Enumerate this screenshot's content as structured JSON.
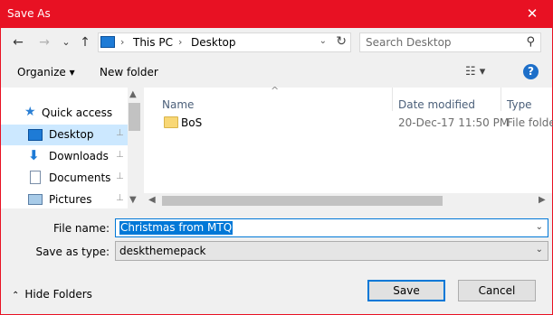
{
  "window": {
    "title": "Save As",
    "close_glyph": "✕"
  },
  "navigation": {
    "back_glyph": "←",
    "forward_glyph": "→",
    "recent_glyph": "⌄",
    "up_glyph": "↑",
    "breadcrumb": [
      "This PC",
      "Desktop"
    ],
    "crumb_sep": "›",
    "dropdown_glyph": "⌄",
    "refresh_glyph": "↻"
  },
  "search": {
    "placeholder": "Search Desktop",
    "icon": "search-icon",
    "icon_glyph": "⚲"
  },
  "toolbar": {
    "organize_label": "Organize ▾",
    "new_folder_label": "New folder",
    "view_glyph": "☷ ▾",
    "help_glyph": "?"
  },
  "sidebar": {
    "items": [
      {
        "label": "Quick access",
        "icon": "star-icon",
        "pinned": false,
        "selected": false
      },
      {
        "label": "Desktop",
        "icon": "desktop-icon",
        "pinned": true,
        "selected": true
      },
      {
        "label": "Downloads",
        "icon": "download-icon",
        "pinned": true,
        "selected": false
      },
      {
        "label": "Documents",
        "icon": "document-icon",
        "pinned": true,
        "selected": false
      },
      {
        "label": "Pictures",
        "icon": "pictures-icon",
        "pinned": true,
        "selected": false
      }
    ],
    "pin_glyph": "📌"
  },
  "file_list": {
    "sort_glyph": "^",
    "columns": [
      "Name",
      "Date modified",
      "Type"
    ],
    "rows": [
      {
        "name": "BoS",
        "date_modified": "20-Dec-17 11:50 PM",
        "type": "File folder"
      }
    ]
  },
  "form": {
    "file_name_label": "File name:",
    "file_name_value": "Christmas from MTQ",
    "save_as_type_label": "Save as type:",
    "save_as_type_value": "deskthemepack",
    "dropdown_glyph": "⌄"
  },
  "footer": {
    "hide_folders_label": "Hide Folders",
    "hide_folders_glyph": "⌃",
    "save_label": "Save",
    "cancel_label": "Cancel"
  },
  "colors": {
    "accent": "#e81123",
    "selection": "#0078d7",
    "nav_selected": "#cce8ff"
  }
}
